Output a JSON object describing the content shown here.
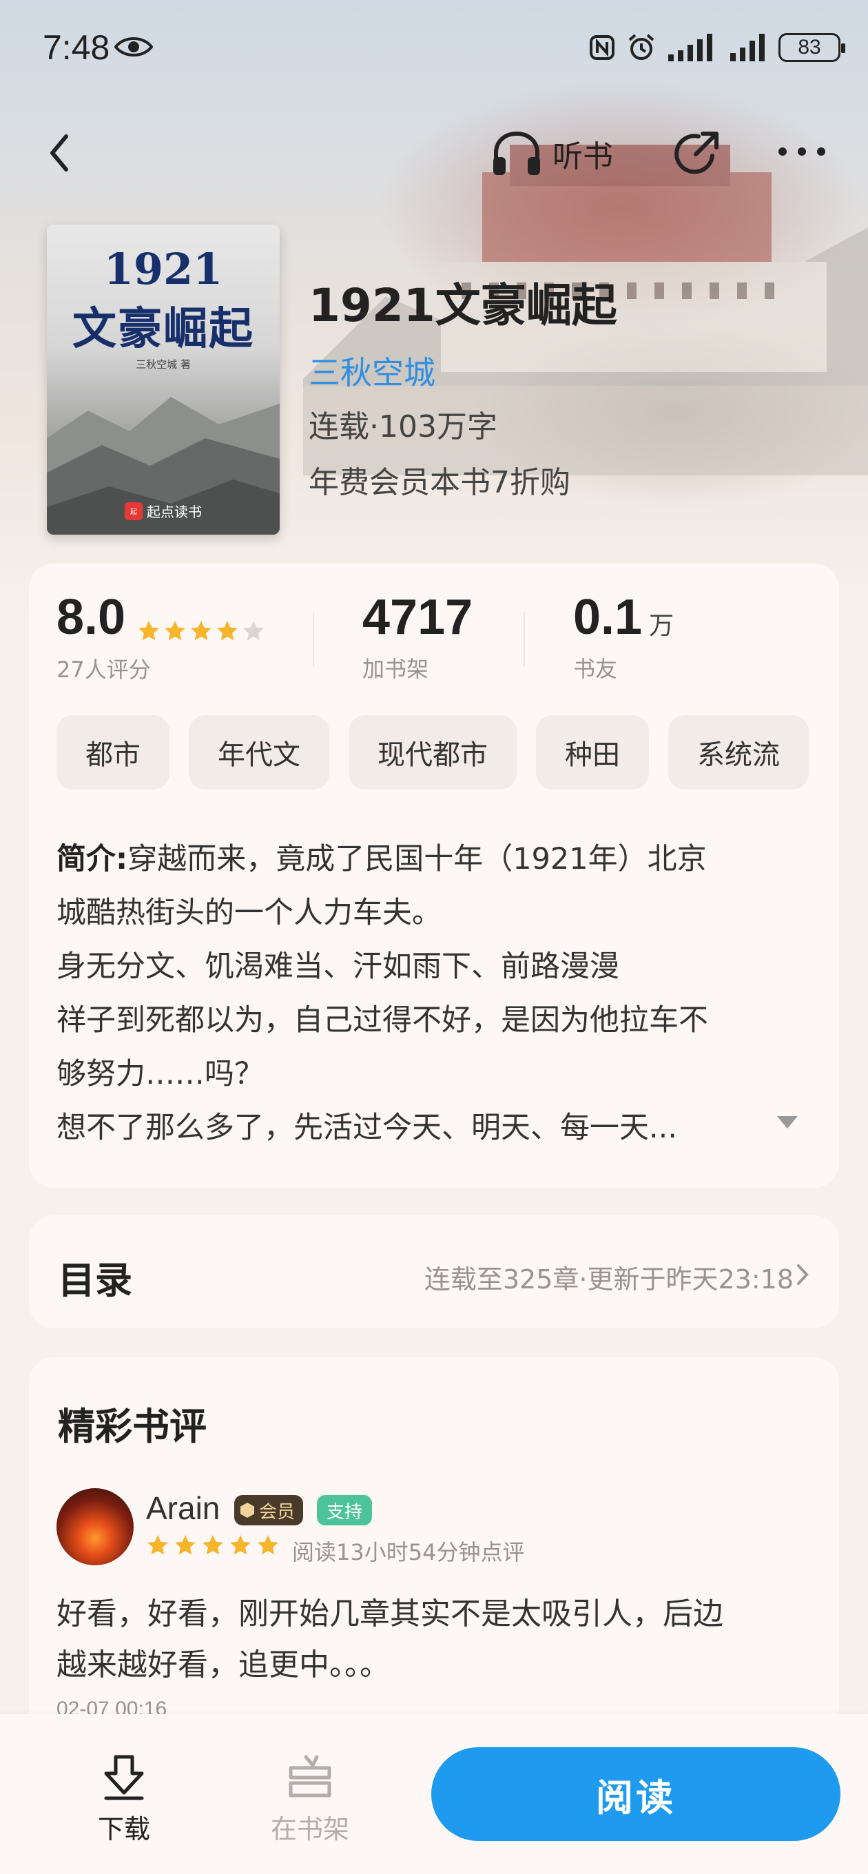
{
  "status_bar": {
    "time": "7:48",
    "battery": "83"
  },
  "nav": {
    "listen_label": "听书"
  },
  "book": {
    "cover_title_line1": "1921",
    "cover_title_line2": "文豪崛起",
    "cover_author": "三秋空城 著",
    "cover_publisher": "起点读书",
    "title": "1921文豪崛起",
    "author": "三秋空城",
    "meta": "连载·103万字",
    "promo": "年费会员本书7折购"
  },
  "stats": {
    "rating": "8.0",
    "rating_stars_filled": 4,
    "rating_label": "27人评分",
    "shelf_count": "4717",
    "shelf_label": "加书架",
    "fans_value": "0.1",
    "fans_unit": "万",
    "fans_label": "书友"
  },
  "tags": [
    "都市",
    "年代文",
    "现代都市",
    "种田",
    "系统流"
  ],
  "intro": {
    "label": "简介:",
    "lines": [
      "穿越而来，竟成了民国十年（1921年）北京",
      "城酷热街头的一个人力车夫。",
      "身无分文、饥渴难当、汗如雨下、前路漫漫",
      "祥子到死都以为，自己过得不好，是因为他拉车不",
      "够努力……吗？",
      "想不了那么多了，先活过今天、明天、每一天..."
    ]
  },
  "toc": {
    "title": "目录",
    "info": "连载至325章·更新于昨天23:18"
  },
  "reviews": {
    "title": "精彩书评",
    "items": [
      {
        "name": "Arain",
        "badge_member": "会员",
        "badge_support": "支持",
        "stars": 5,
        "meta": "阅读13小时54分钟点评",
        "text_line1": "好看，好看，刚开始几章其实不是太吸引人，后边",
        "text_line2": "越来越好看，追更中。。。",
        "date": "02-07 00:16"
      }
    ]
  },
  "bottom": {
    "download_label": "下载",
    "shelf_label": "在书架",
    "read_label": "阅读"
  },
  "colors": {
    "accent": "#1e9bef",
    "author_link": "#2f8fe2",
    "star": "#f7b52c",
    "support_badge": "#4cc39b"
  }
}
